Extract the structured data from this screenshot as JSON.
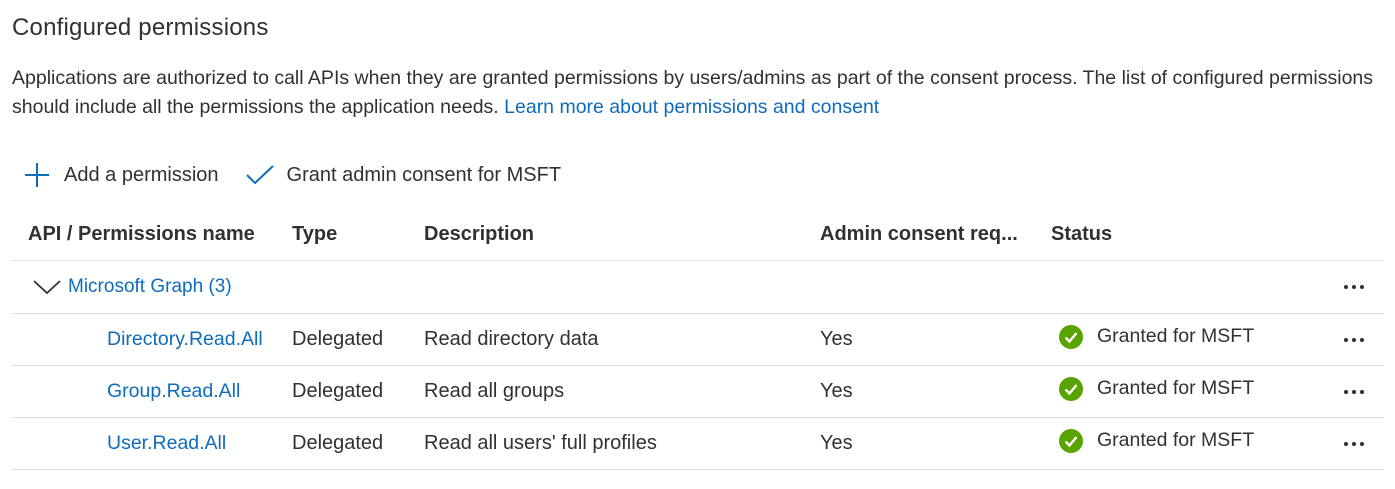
{
  "section": {
    "title": "Configured permissions",
    "description": "Applications are authorized to call APIs when they are granted permissions by users/admins as part of the consent process. The list of configured permissions should include all the permissions the application needs.",
    "learn_more_link": "Learn more about permissions and consent"
  },
  "toolbar": {
    "add_label": "Add a permission",
    "add_icon": "plus-icon",
    "grant_label": "Grant admin consent for MSFT",
    "grant_icon": "checkmark-icon"
  },
  "table": {
    "headers": {
      "name": "API / Permissions name",
      "type": "Type",
      "description": "Description",
      "admin": "Admin consent req...",
      "status": "Status"
    },
    "group": {
      "label": "Microsoft Graph (3)",
      "expanded": true
    },
    "rows": [
      {
        "name": "Directory.Read.All",
        "type": "Delegated",
        "description": "Read directory data",
        "admin": "Yes",
        "status": "Granted for MSFT"
      },
      {
        "name": "Group.Read.All",
        "type": "Delegated",
        "description": "Read all groups",
        "admin": "Yes",
        "status": "Granted for MSFT"
      },
      {
        "name": "User.Read.All",
        "type": "Delegated",
        "description": "Read all users' full profiles",
        "admin": "Yes",
        "status": "Granted for MSFT"
      }
    ]
  },
  "colors": {
    "link": "#0f6cbd",
    "success": "#57a300",
    "text": "#323130",
    "divider": "#e1dfdd"
  }
}
